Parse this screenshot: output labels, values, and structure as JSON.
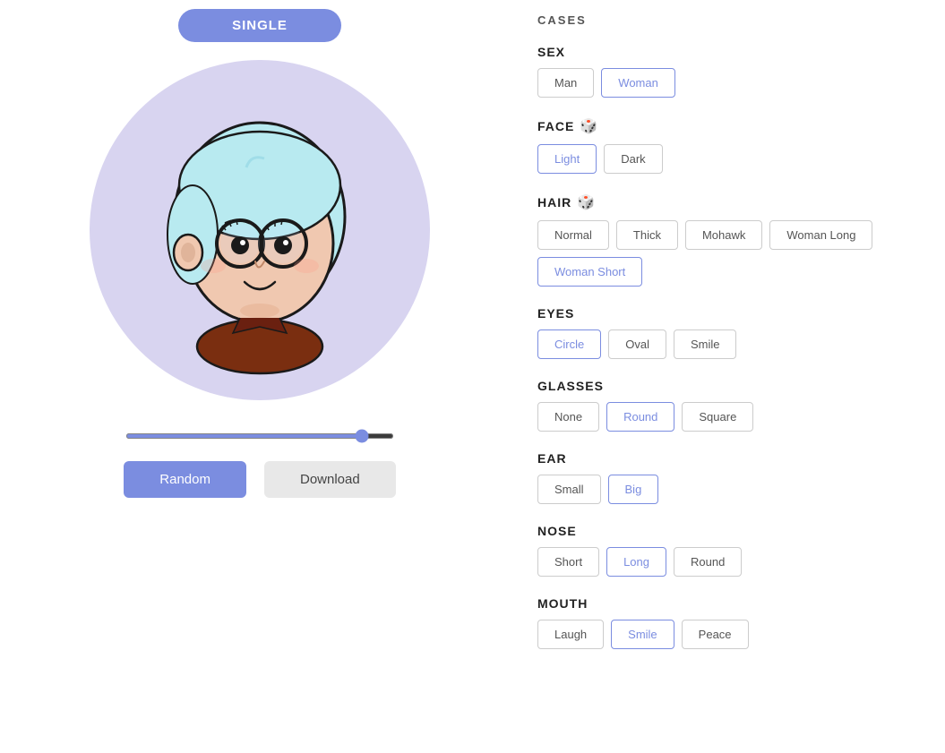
{
  "header": {
    "single_label": "SINGLE"
  },
  "cases_title": "CASES",
  "sections": [
    {
      "id": "sex",
      "label": "SEX",
      "has_dice": false,
      "options": [
        "Man",
        "Woman"
      ],
      "selected": "Woman"
    },
    {
      "id": "face",
      "label": "FACE",
      "has_dice": true,
      "options": [
        "Light",
        "Dark"
      ],
      "selected": "Light"
    },
    {
      "id": "hair",
      "label": "HAIR",
      "has_dice": true,
      "options": [
        "Normal",
        "Thick",
        "Mohawk",
        "Woman Long",
        "Woman Short"
      ],
      "selected": "Woman Short"
    },
    {
      "id": "eyes",
      "label": "EYES",
      "has_dice": false,
      "options": [
        "Circle",
        "Oval",
        "Smile"
      ],
      "selected": "Circle"
    },
    {
      "id": "glasses",
      "label": "GLASSES",
      "has_dice": false,
      "options": [
        "None",
        "Round",
        "Square"
      ],
      "selected": "Round"
    },
    {
      "id": "ear",
      "label": "EAR",
      "has_dice": false,
      "options": [
        "Small",
        "Big"
      ],
      "selected": "Big"
    },
    {
      "id": "nose",
      "label": "NOSE",
      "has_dice": false,
      "options": [
        "Short",
        "Long",
        "Round"
      ],
      "selected": "Long"
    },
    {
      "id": "mouth",
      "label": "MOUTH",
      "has_dice": false,
      "options": [
        "Laugh",
        "Smile",
        "Peace"
      ],
      "selected": "Smile"
    }
  ],
  "buttons": {
    "random": "Random",
    "download": "Download"
  },
  "colors": {
    "accent": "#7b8de0",
    "selected_border": "#7b8de0",
    "selected_text": "#7b8de0"
  }
}
